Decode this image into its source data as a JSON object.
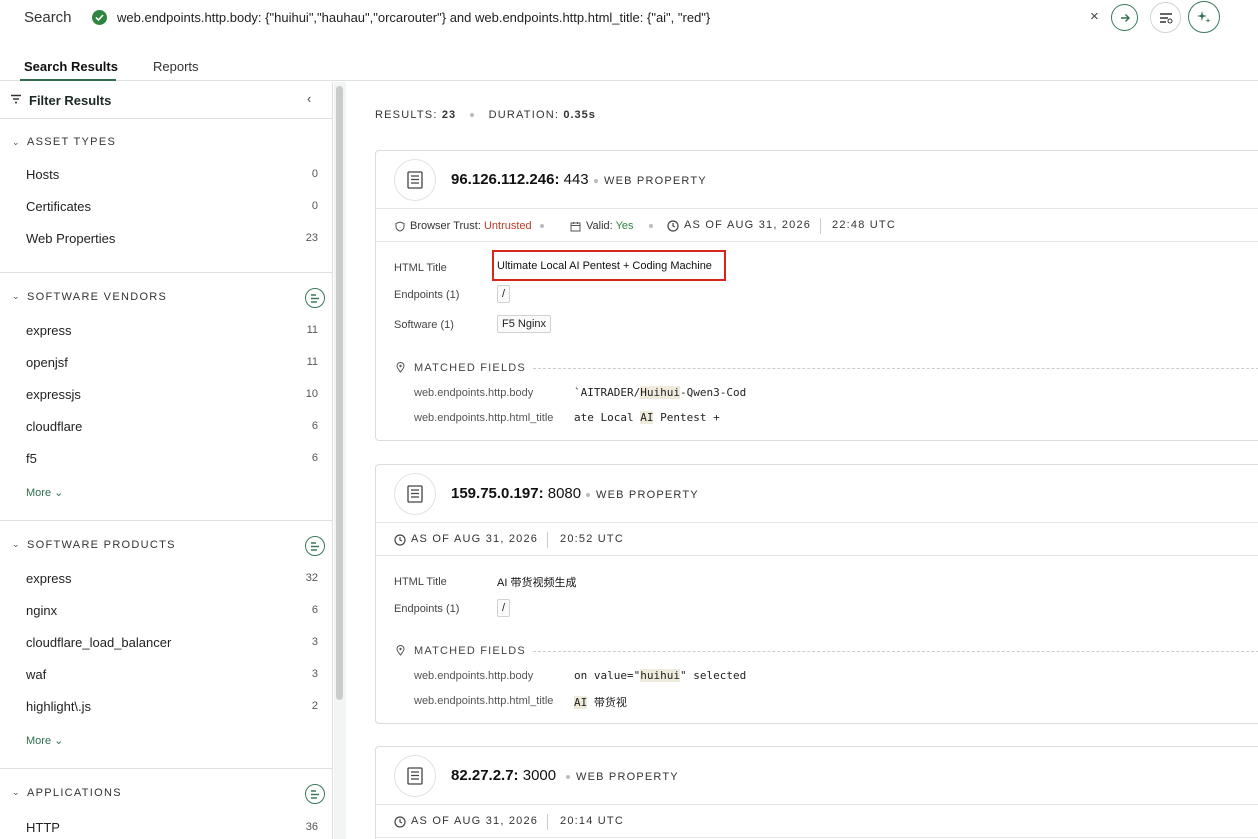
{
  "search": {
    "label": "Search",
    "query": "web.endpoints.http.body: {\"huihui\",\"hauhau\",\"orcarouter\"} and web.endpoints.http.html_title: {\"ai\", \"red\"}",
    "clear": "×"
  },
  "tabs": [
    {
      "label": "Search Results",
      "active": true
    },
    {
      "label": "Reports",
      "active": false
    }
  ],
  "sidebar": {
    "title": "Filter Results",
    "sections": [
      {
        "heading": "ASSET TYPES",
        "items": [
          {
            "label": "Hosts",
            "count": "0"
          },
          {
            "label": "Certificates",
            "count": "0"
          },
          {
            "label": "Web Properties",
            "count": "23"
          }
        ]
      },
      {
        "heading": "SOFTWARE VENDORS",
        "items": [
          {
            "label": "express",
            "count": "11"
          },
          {
            "label": "openjsf",
            "count": "11"
          },
          {
            "label": "expressjs",
            "count": "10"
          },
          {
            "label": "cloudflare",
            "count": "6"
          },
          {
            "label": "f5",
            "count": "6"
          }
        ],
        "more": "More"
      },
      {
        "heading": "SOFTWARE PRODUCTS",
        "items": [
          {
            "label": "express",
            "count": "32"
          },
          {
            "label": "nginx",
            "count": "6"
          },
          {
            "label": "cloudflare_load_balancer",
            "count": "3"
          },
          {
            "label": "waf",
            "count": "3"
          },
          {
            "label": "highlight\\.js",
            "count": "2"
          }
        ],
        "more": "More"
      },
      {
        "heading": "APPLICATIONS",
        "items": [
          {
            "label": "HTTP",
            "count": "36"
          }
        ]
      }
    ]
  },
  "summary": {
    "results_label": "RESULTS:",
    "results_value": "23",
    "duration_label": "DURATION:",
    "duration_value": "0.35s"
  },
  "results": [
    {
      "ip": "96.126.112.246:",
      "port": "443",
      "type": "WEB PROPERTY",
      "trust_label": "Browser Trust:",
      "trust_value": "Untrusted",
      "valid_label": "Valid:",
      "valid_value": "Yes",
      "asof": "AS OF",
      "date": "AUG 31, 2026",
      "time": "22:48 UTC",
      "html_title_label": "HTML Title",
      "html_title": "Ultimate Local AI Pentest + Coding Machine",
      "endpoints_label": "Endpoints (1)",
      "endpoint": "/",
      "software_label": "Software (1)",
      "software": "F5 Nginx",
      "matched_label": "MATCHED FIELDS",
      "matched": [
        {
          "key": "web.endpoints.http.body",
          "pre": "`AITRADER/",
          "hl": "Huihui",
          "post": "-Qwen3-Cod"
        },
        {
          "key": "web.endpoints.http.html_title",
          "pre": "ate Local ",
          "hl": "AI",
          "post": " Pentest +"
        }
      ]
    },
    {
      "ip": "159.75.0.197:",
      "port": "8080",
      "type": "WEB PROPERTY",
      "asof": "AS OF",
      "date": "AUG 31, 2026",
      "time": "20:52 UTC",
      "html_title_label": "HTML Title",
      "html_title": "AI 带货视频生成",
      "endpoints_label": "Endpoints (1)",
      "endpoint": "/",
      "matched_label": "MATCHED FIELDS",
      "matched": [
        {
          "key": "web.endpoints.http.body",
          "pre": "on value=\"",
          "hl": "huihui",
          "post": "\" selected"
        },
        {
          "key": "web.endpoints.http.html_title",
          "pre": "",
          "hl": "AI",
          "post": " 带货视"
        }
      ]
    },
    {
      "ip": "82.27.2.7:",
      "port": "3000",
      "type": "WEB PROPERTY",
      "asof": "AS OF",
      "date": "AUG 31, 2026",
      "time": "20:14 UTC"
    }
  ],
  "colors": {
    "accent": "#2f6f4f",
    "untrusted": "#c0392b",
    "valid": "#2e8540",
    "highlight_box": "#d9261c"
  },
  "icons": [
    "check-circle-icon",
    "close-icon",
    "arrow-right-icon",
    "query-options-icon",
    "ai-sparkle-icon",
    "filter-icon",
    "chevron-left-icon",
    "chevron-down-icon",
    "list-summary-icon",
    "web-page-icon",
    "shield-icon",
    "calendar-icon",
    "clock-icon",
    "pin-icon"
  ]
}
